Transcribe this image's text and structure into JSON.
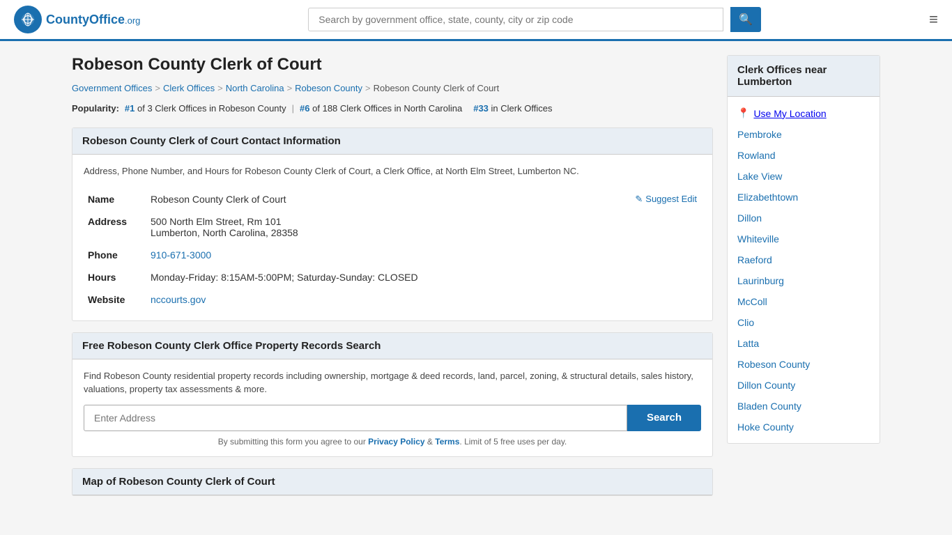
{
  "header": {
    "logo_text": "CountyOffice",
    "logo_org": ".org",
    "search_placeholder": "Search by government office, state, county, city or zip code",
    "search_icon": "🔍",
    "menu_icon": "≡"
  },
  "page": {
    "title": "Robeson County Clerk of Court",
    "breadcrumbs": [
      {
        "label": "Government Offices",
        "href": "#"
      },
      {
        "label": "Clerk Offices",
        "href": "#"
      },
      {
        "label": "North Carolina",
        "href": "#"
      },
      {
        "label": "Robeson County",
        "href": "#"
      },
      {
        "label": "Robeson County Clerk of Court",
        "href": "#"
      }
    ],
    "popularity": {
      "label": "Popularity:",
      "rank1": "#1",
      "rank1_text": "of 3 Clerk Offices in Robeson County",
      "rank2": "#6",
      "rank2_text": "of 188 Clerk Offices in North Carolina",
      "rank3": "#33",
      "rank3_text": "in Clerk Offices"
    },
    "contact_section": {
      "header": "Robeson County Clerk of Court Contact Information",
      "description": "Address, Phone Number, and Hours for Robeson County Clerk of Court, a Clerk Office, at North Elm Street, Lumberton NC.",
      "suggest_edit": "Suggest Edit",
      "fields": {
        "name_label": "Name",
        "name_value": "Robeson County Clerk of Court",
        "address_label": "Address",
        "address_line1": "500 North Elm Street, Rm 101",
        "address_line2": "Lumberton, North Carolina, 28358",
        "phone_label": "Phone",
        "phone_value": "910-671-3000",
        "hours_label": "Hours",
        "hours_value": "Monday-Friday: 8:15AM-5:00PM; Saturday-Sunday: CLOSED",
        "website_label": "Website",
        "website_value": "nccourts.gov",
        "website_href": "#"
      }
    },
    "property_section": {
      "header": "Free Robeson County Clerk Office Property Records Search",
      "description": "Find Robeson County residential property records including ownership, mortgage & deed records, land, parcel, zoning, & structural details, sales history, valuations, property tax assessments & more.",
      "address_placeholder": "Enter Address",
      "search_btn_label": "Search",
      "disclaimer": "By submitting this form you agree to our",
      "privacy_label": "Privacy Policy",
      "and": "&",
      "terms_label": "Terms",
      "limit_text": "Limit of 5 free uses per day."
    },
    "map_section": {
      "header": "Map of Robeson County Clerk of Court"
    }
  },
  "sidebar": {
    "title": "Clerk Offices near Lumberton",
    "use_location": "Use My Location",
    "items": [
      {
        "label": "Pembroke"
      },
      {
        "label": "Rowland"
      },
      {
        "label": "Lake View"
      },
      {
        "label": "Elizabethtown"
      },
      {
        "label": "Dillon"
      },
      {
        "label": "Whiteville"
      },
      {
        "label": "Raeford"
      },
      {
        "label": "Laurinburg"
      },
      {
        "label": "McColl"
      },
      {
        "label": "Clio"
      },
      {
        "label": "Latta"
      },
      {
        "label": "Robeson County"
      },
      {
        "label": "Dillon County"
      },
      {
        "label": "Bladen County"
      },
      {
        "label": "Hoke County"
      }
    ]
  }
}
